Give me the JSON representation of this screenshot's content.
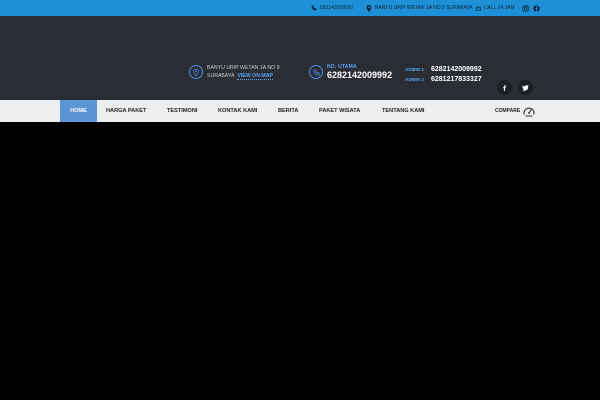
{
  "topbar": {
    "phone": "082142009992",
    "address": "BANYU URIP WETAN 1A NO 9 SURABAYA",
    "call": "CALL 24 JAM",
    "social": [
      "instagram-icon",
      "facebook-icon"
    ]
  },
  "header": {
    "address_line1": "BANYU URIP WETAN 1A NO 9",
    "address_line2": "SURABAYA",
    "view_on_map": "VIEW ON MAP",
    "phone_label": "NO. UTAMA",
    "phone_number": "6282142009992",
    "admin1_label": "ADMIN 1",
    "admin1_number": "6282142009992",
    "admin2_label": "ADMIN 2",
    "admin2_number": "6281217833327"
  },
  "nav": {
    "items": [
      "HOME",
      "HARGA PAKET",
      "TESTIMONI",
      "KONTAK KAMI",
      "BERITA",
      "PAKET WISATA",
      "TENTANG KAMI"
    ],
    "compare": "COMPARE"
  },
  "colors": {
    "topbar": "#1e90d8",
    "header": "#2a2d33",
    "accent": "#5aa4f5",
    "nav_active": "#5b95d6",
    "nav_bg": "#eceef0",
    "hero": "#000000"
  }
}
